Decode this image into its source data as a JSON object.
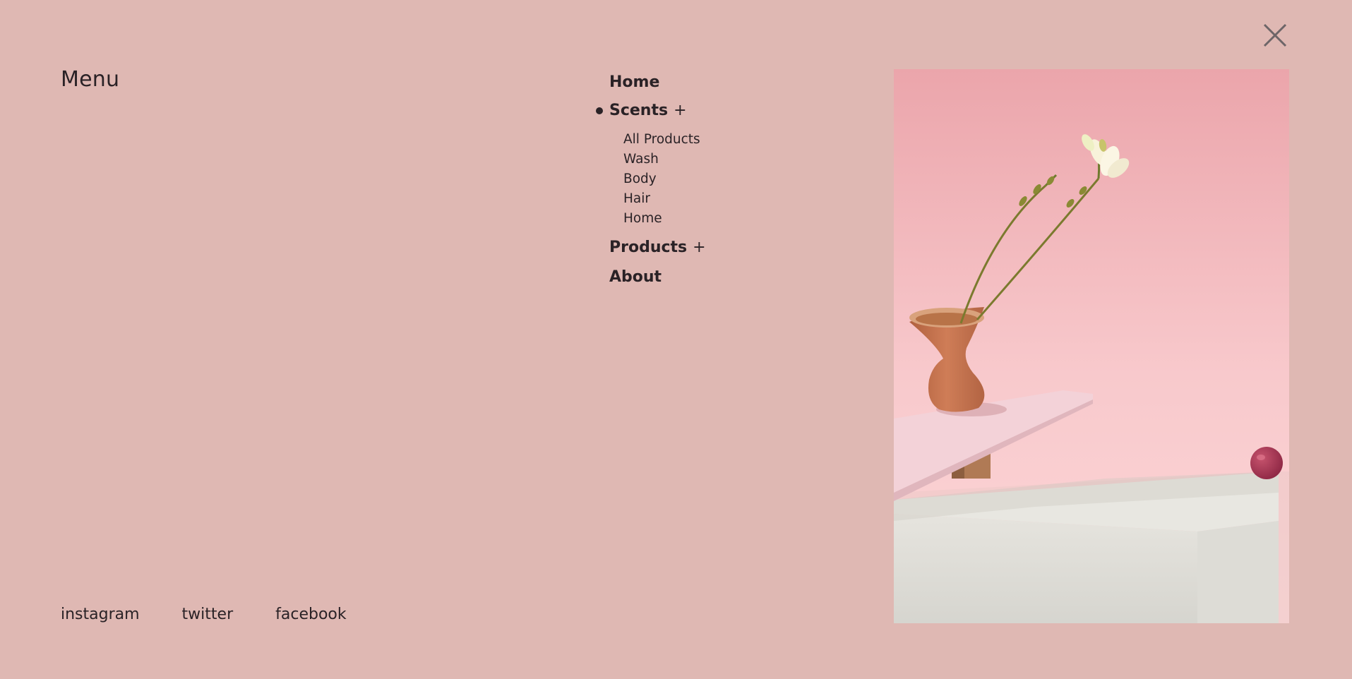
{
  "menu": {
    "title": "Menu"
  },
  "nav": {
    "home": "Home",
    "scents": "Scents",
    "scents_toggle": "+",
    "scents_sub": [
      "All Products",
      "Wash",
      "Body",
      "Hair",
      "Home"
    ],
    "products": "Products",
    "products_toggle": "+",
    "about": "About"
  },
  "social": {
    "instagram": "instagram",
    "twitter": "twitter",
    "facebook": "facebook"
  },
  "colors": {
    "background": "#dfb8b3",
    "text": "#2a2226",
    "close_icon": "#6d6568"
  },
  "icons": {
    "close": "close-icon",
    "active_bullet": "active-bullet-icon"
  }
}
